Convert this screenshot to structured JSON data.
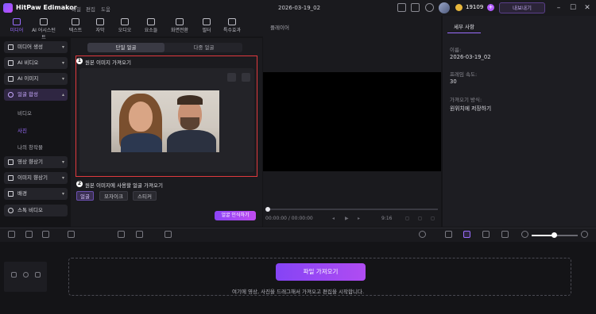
{
  "app": {
    "name": "HitPaw Edimakor",
    "doc_title": "2026-03-19_02",
    "credits": "19109",
    "upgrade_label": "내보내기"
  },
  "menu": [
    "파일",
    "편집",
    "도움"
  ],
  "toolbar": [
    {
      "label": "미디어",
      "icon": "folder-icon",
      "active": true
    },
    {
      "label": "AI 어시스턴트",
      "icon": "ai-icon"
    },
    {
      "label": "텍스트",
      "icon": "text-icon"
    },
    {
      "label": "자막",
      "icon": "subtitle-icon"
    },
    {
      "label": "오디오",
      "icon": "music-icon"
    },
    {
      "label": "요소들",
      "icon": "elements-icon"
    },
    {
      "label": "화면전환",
      "icon": "transition-icon"
    },
    {
      "label": "필터",
      "icon": "filter-icon"
    },
    {
      "label": "특수효과",
      "icon": "effects-icon"
    }
  ],
  "sidebar": {
    "items": [
      {
        "label": "미디어 생성",
        "icon": "media-icon"
      },
      {
        "label": "AI 비디오",
        "icon": "ai-video-icon"
      },
      {
        "label": "AI 이미지",
        "icon": "ai-image-icon"
      },
      {
        "label": "얼굴 합성",
        "icon": "face-icon",
        "active": true
      }
    ],
    "subitems": [
      "비디오",
      "사진",
      "나의 창작물"
    ],
    "items2": [
      {
        "label": "영상 향상기",
        "icon": "enhance-icon"
      },
      {
        "label": "이미지 향상기",
        "icon": "image-enhance-icon"
      },
      {
        "label": "배경",
        "icon": "background-icon"
      },
      {
        "label": "스톡 비디오",
        "icon": "stock-icon"
      }
    ]
  },
  "faceswap": {
    "tab_single": "단일 얼굴",
    "tab_multi": "다중 얼굴",
    "step1_num": "1",
    "step1_label": "원본 이미지 가져오기",
    "step2_num": "2",
    "step2_label": "원본 이미지에 사용할 얼굴 가져오기",
    "chips": [
      "얼굴",
      "모자이크",
      "스티커"
    ],
    "recognize_btn": "얼굴 인식하기"
  },
  "player": {
    "label": "플레이어",
    "time": "00:00:00 / 00:00:00",
    "ratio": "9:16"
  },
  "properties": {
    "tab": "세부 사항",
    "name_label": "이름:",
    "name_value": "2026-03-19_02",
    "fps_label": "프레임 속도:",
    "fps_value": "30",
    "import_label": "가져오기 방식:",
    "import_value": "원위치에 저장하기"
  },
  "timeline": {
    "import_btn": "파일 가져오기",
    "hint": "여기에 영상, 사진을 드래그해서 가져오고 편집을 시작합니다.",
    "zoom": 0.45
  }
}
